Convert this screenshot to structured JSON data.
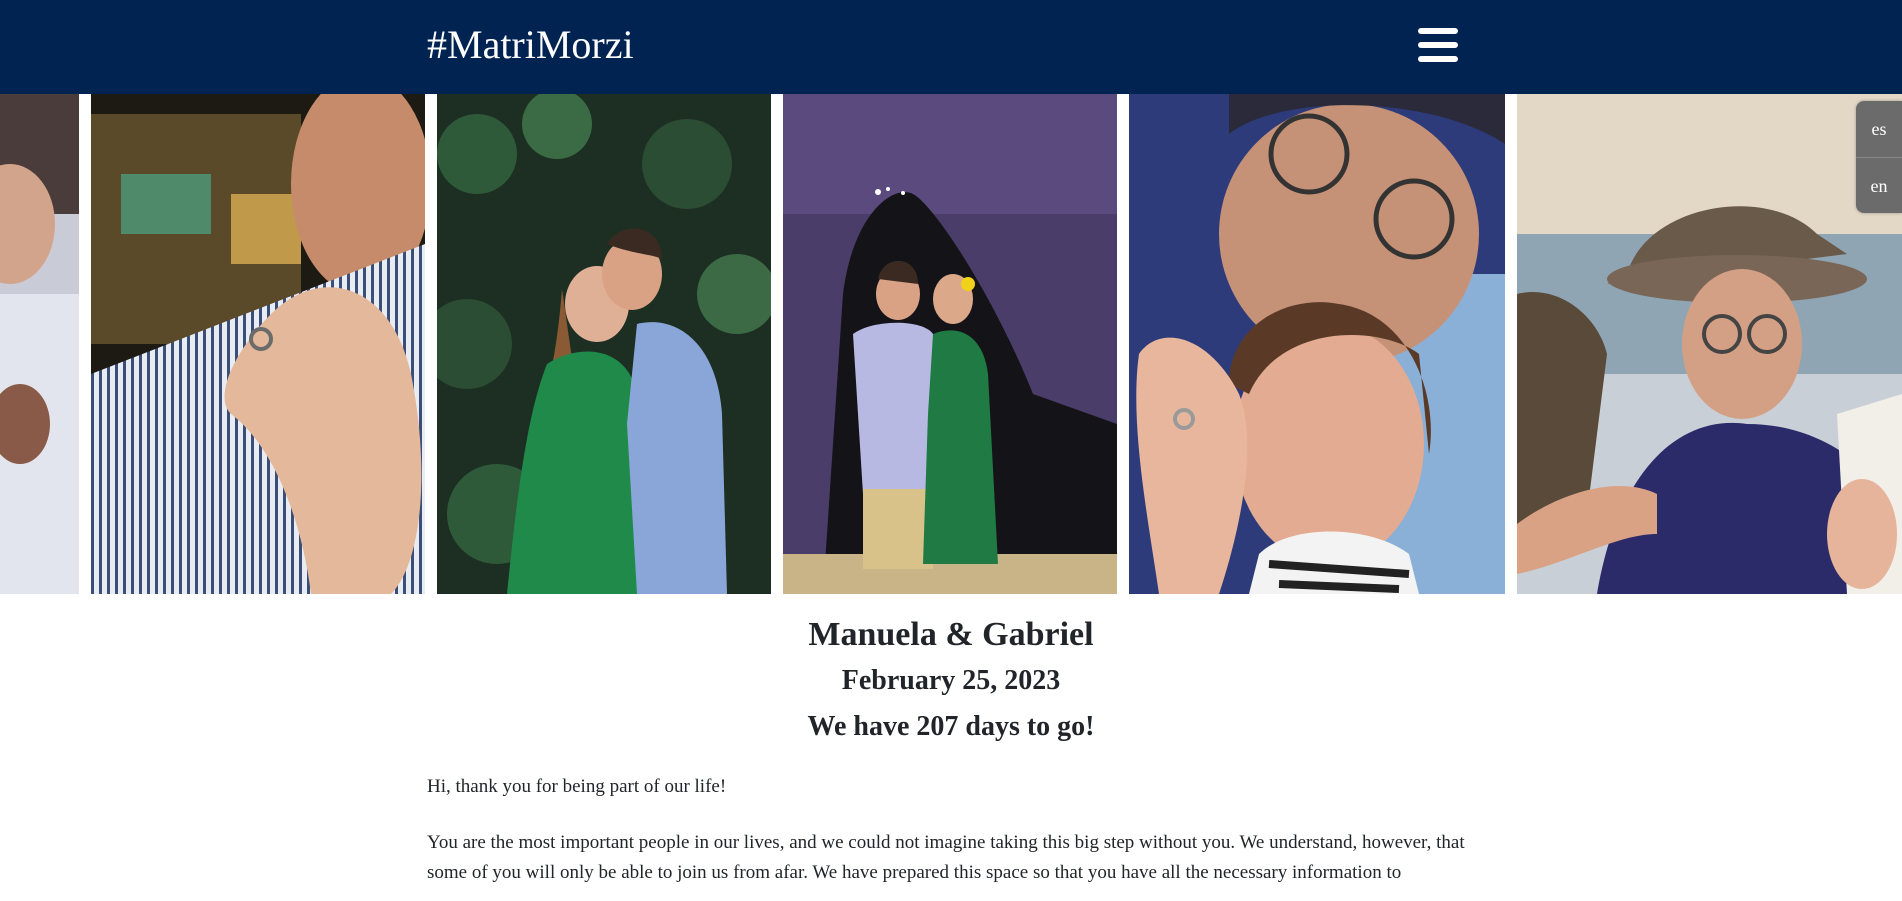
{
  "header": {
    "brand": "#MatriMorzi",
    "menu_icon": "hamburger-menu-icon",
    "background": "#012352"
  },
  "gallery": {
    "photos": [
      {
        "description": "couple close-up, partially visible"
      },
      {
        "description": "hand with engagement ring on striped shirt"
      },
      {
        "description": "couple in green dress and blue shirt among foliage"
      },
      {
        "description": "couple kissing in front of Sugarloaf mountain at dusk"
      },
      {
        "description": "selfie of couple showing ring"
      },
      {
        "description": "man with hat and woman at seaside sunset"
      }
    ]
  },
  "language": {
    "options": [
      "es",
      "en"
    ]
  },
  "hero": {
    "names": "Manuela & Gabriel",
    "date": "February 25, 2023",
    "countdown": "We have 207 days to go!"
  },
  "intro": {
    "greeting": "Hi, thank you for being part of our life!",
    "paragraph": "You are the most important people in our lives, and we could not imagine taking this big step without you. We understand, however, that some of you will only be able to join us from afar. We have prepared this space so that you have all the necessary information to"
  }
}
